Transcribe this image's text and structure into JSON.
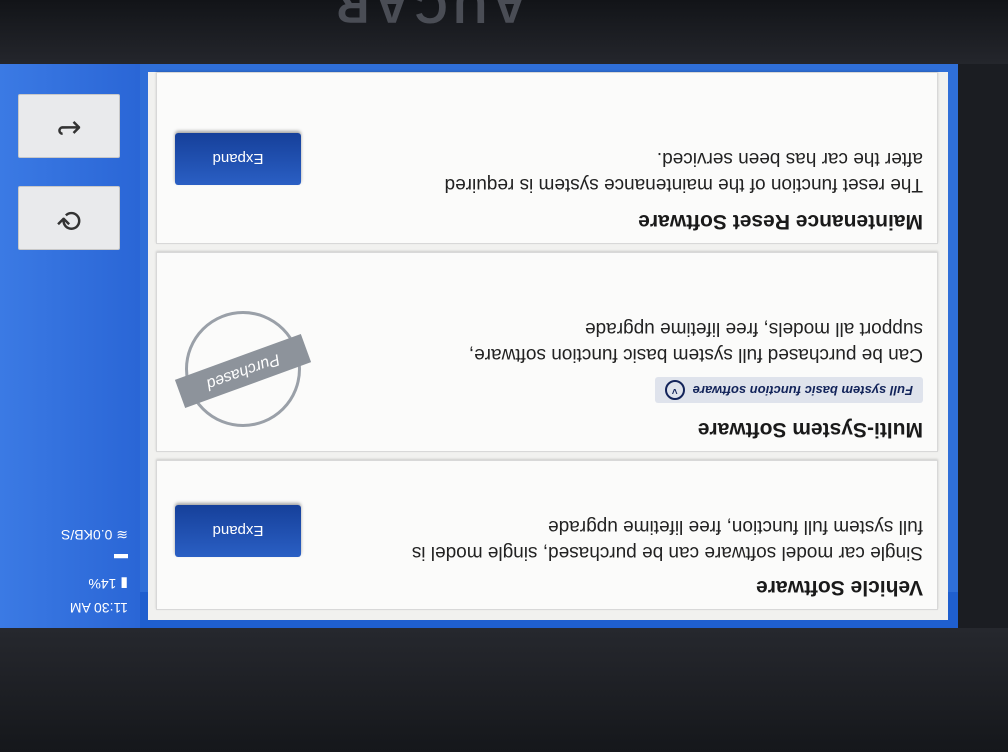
{
  "device": {
    "brand": "AUCAR"
  },
  "status": {
    "time": "11:30 AM",
    "battery": "14%",
    "network": "0.0KB/S"
  },
  "cards": [
    {
      "title": "Vehicle Software",
      "description": "Single car model software can be purchased, single model is full system full function, free lifetime upgrade",
      "button": "Expand"
    },
    {
      "title": "Multi-System Software",
      "tag": "Full system basic function software",
      "description": "Can be purchased full system basic function software, support all models, free lifetime upgrade",
      "stamp": "Purchased"
    },
    {
      "title": "Maintenance Reset Software",
      "description": "The reset function of the maintenance system is required after the car has been serviced.",
      "button": "Expand"
    }
  ],
  "icons": {
    "refresh": "refresh-icon",
    "back": "back-icon"
  },
  "colors": {
    "accent": "#2f6fd8",
    "button": "#16409a"
  }
}
